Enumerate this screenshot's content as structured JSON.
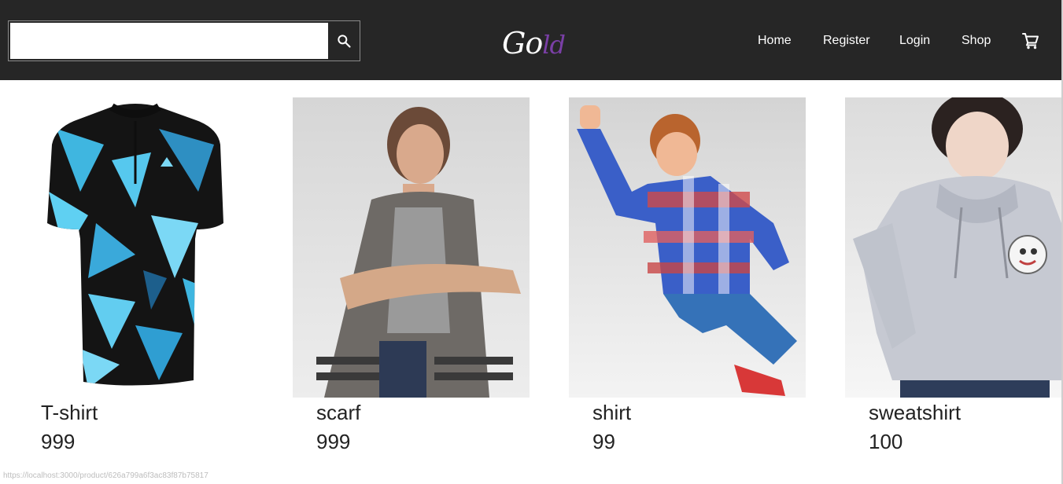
{
  "header": {
    "search": {
      "value": "",
      "placeholder": ""
    },
    "logo": {
      "main": "Go",
      "accent": "ld"
    },
    "nav": [
      "Home",
      "Register",
      "Login",
      "Shop"
    ],
    "icons": {
      "search": "search-icon",
      "cart": "shopping-cart-icon"
    }
  },
  "products": [
    {
      "name": "T-shirt",
      "price": "999"
    },
    {
      "name": "scarf",
      "price": "999"
    },
    {
      "name": "shirt",
      "price": "99"
    },
    {
      "name": "sweatshirt",
      "price": "100"
    }
  ],
  "status_bar": {
    "url": "https://localhost:3000/product/626a799a6f3ac83f87b75817"
  },
  "colors": {
    "navbar": "#262626",
    "logo_accent": "#7a3fa6",
    "text": "#222222"
  }
}
